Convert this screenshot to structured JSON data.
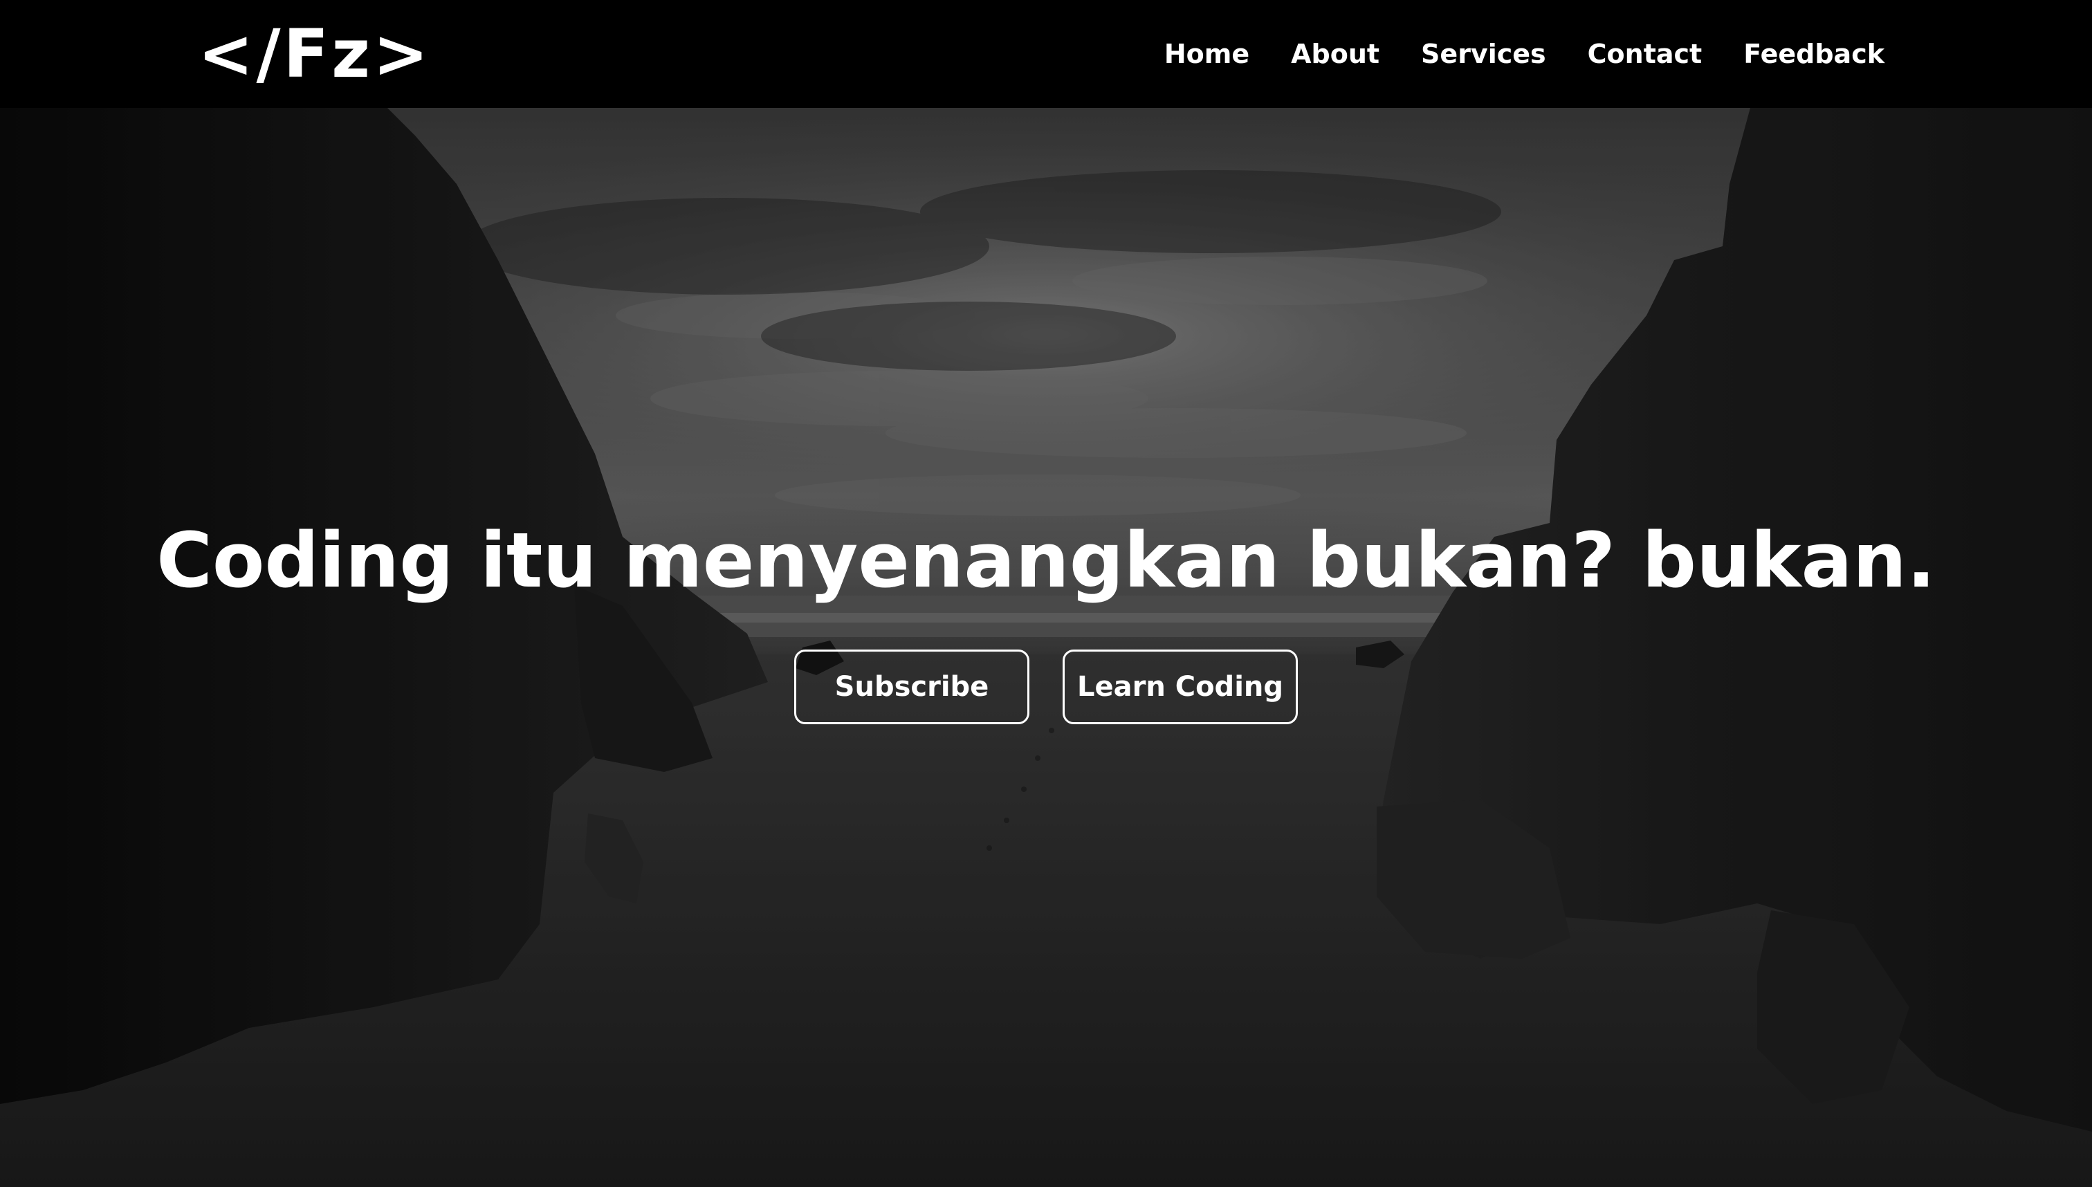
{
  "navbar": {
    "logo": "</Fz>",
    "links": [
      "Home",
      "About",
      "Services",
      "Contact",
      "Feedback"
    ]
  },
  "hero": {
    "title": "Coding itu menyenangkan bukan? bukan.",
    "buttons": [
      "Subscribe",
      "Learn Coding"
    ],
    "background": "grayscale photo of beach between rock cliffs under cloudy sky"
  },
  "colors": {
    "navbar_bg": "#000000",
    "text": "#ffffff",
    "button_border": "#ffffff"
  }
}
